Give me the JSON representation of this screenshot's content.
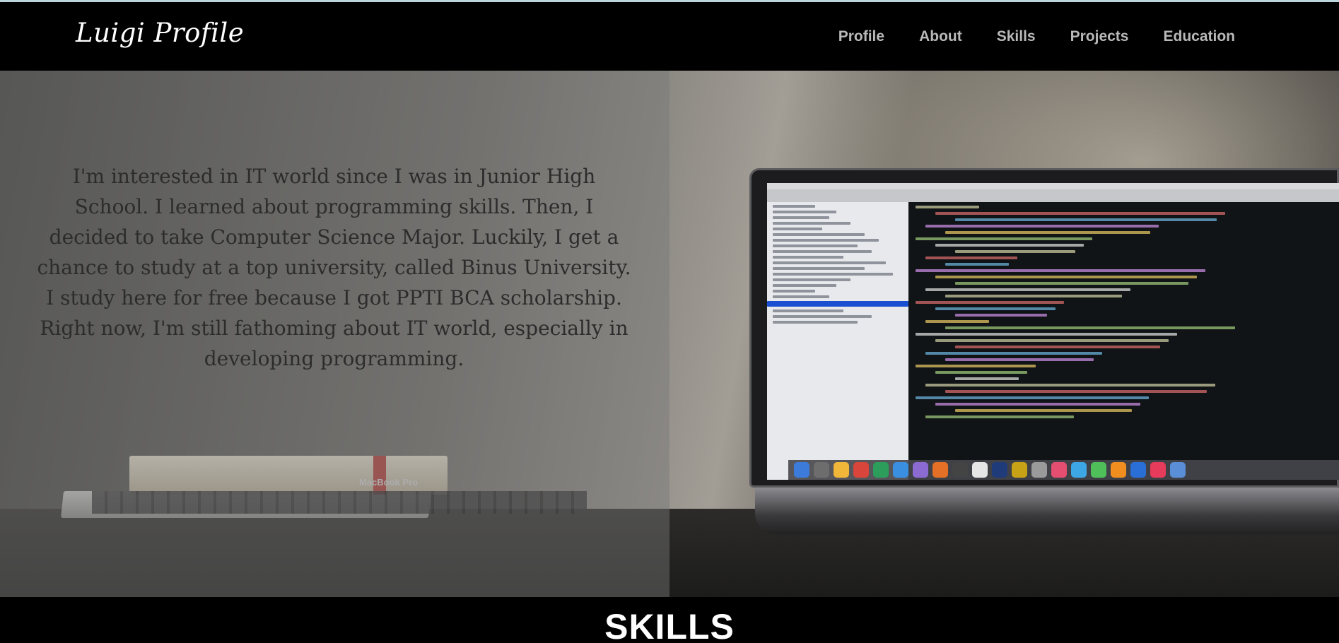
{
  "navbar": {
    "brand": "Luigi Profile",
    "links": [
      "Profile",
      "About",
      "Skills",
      "Projects",
      "Education"
    ]
  },
  "hero": {
    "text": "I'm interested in IT world since I was in Junior High School. I learned about programming skills. Then, I decided to take Computer Science Major. Luckily, I get a chance to study at a top university, called Binus University. I study here for free because I got PPTI BCA scholarship. Right now, I'm still fathoming about IT world, especially in developing programming.",
    "image_label": "MacBook Pro"
  },
  "skills": {
    "title": "SKILLS"
  },
  "colors": {
    "navbar_bg": "#000000",
    "nav_link": "#b9b9b9",
    "hero_text": "#2c2c2c",
    "accent_strip": "#b9d6da"
  }
}
